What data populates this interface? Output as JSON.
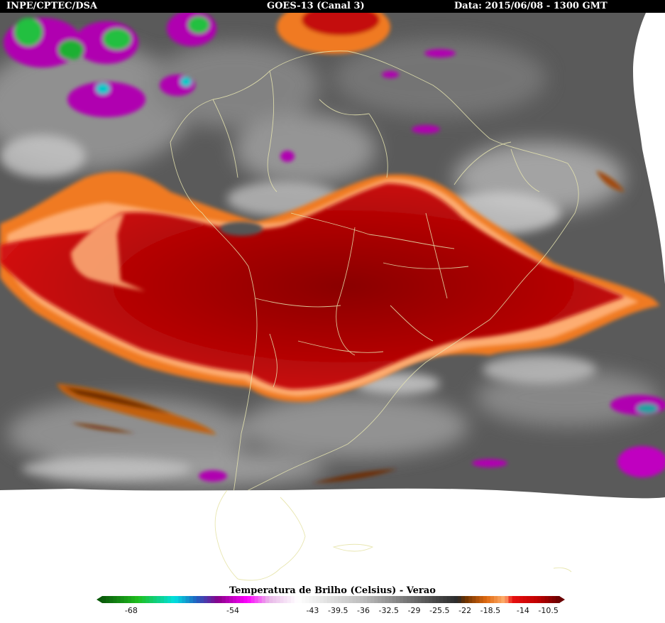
{
  "header": {
    "source": "INPE/CPTEC/DSA",
    "satellite": "GOES-13 (Canal 3)",
    "date": "Data: 2015/06/08 - 1300 GMT"
  },
  "legend": {
    "title": "Temperatura de Brilho (Celsius) - Verao",
    "min": -72,
    "max": -9,
    "ticks": [
      "-68",
      "-54",
      "-43",
      "-39.5",
      "-36",
      "-32.5",
      "-29",
      "-25.5",
      "-22",
      "-18.5",
      "-14",
      "-10.5"
    ],
    "stops": [
      {
        "t": -72,
        "color": "#0a5a0a"
      },
      {
        "t": -67,
        "color": "#1fbf1f"
      },
      {
        "t": -62,
        "color": "#00e0e0"
      },
      {
        "t": -59,
        "color": "#2060c0"
      },
      {
        "t": -56,
        "color": "#8a008a"
      },
      {
        "t": -52,
        "color": "#ff00ff"
      },
      {
        "t": -49,
        "color": "#e8b8e8"
      },
      {
        "t": -45,
        "color": "#ffffff"
      },
      {
        "t": -36,
        "color": "#bcbcbc"
      },
      {
        "t": -26,
        "color": "#484848"
      },
      {
        "t": -23,
        "color": "#2a2a2a"
      },
      {
        "t": -22,
        "color": "#6a3000"
      },
      {
        "t": -19,
        "color": "#e06a10"
      },
      {
        "t": -16.5,
        "color": "#ffb070"
      },
      {
        "t": -15.5,
        "color": "#e81010"
      },
      {
        "t": -12,
        "color": "#c00000"
      },
      {
        "t": -9,
        "color": "#6a0000"
      }
    ]
  },
  "colors": {
    "cloud_red": "#c20a0a",
    "cloud_darkred": "#8e0000",
    "cloud_orange": "#f07a20",
    "cloud_peach": "#ffb27a",
    "border_lines": "#e8e6b0"
  }
}
